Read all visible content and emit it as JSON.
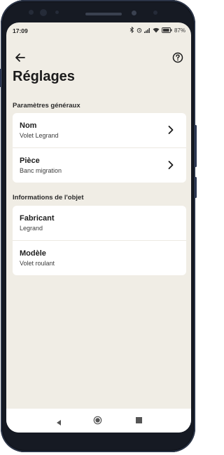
{
  "status_bar": {
    "time": "17:09",
    "battery": "87",
    "icons": [
      "bluetooth-icon",
      "alarm-icon",
      "signal-icon",
      "wifi-icon",
      "battery-icon"
    ]
  },
  "header": {
    "back_icon": "arrow-left-icon",
    "help_icon": "question-circle-icon",
    "title": "Réglages"
  },
  "sections": [
    {
      "label": "Paramètres généraux",
      "rows": [
        {
          "label": "Nom",
          "value": "Volet Legrand",
          "chevron": true
        },
        {
          "label": "Pièce",
          "value": "Banc migration",
          "chevron": true
        }
      ]
    },
    {
      "label": "Informations de l'objet",
      "rows": [
        {
          "label": "Fabricant",
          "value": "Legrand",
          "chevron": false
        },
        {
          "label": "Modèle",
          "value": "Volet roulant",
          "chevron": false
        }
      ]
    }
  ],
  "nav_bar": {
    "icons": [
      "nav-back-icon",
      "nav-home-icon",
      "nav-recents-icon"
    ]
  },
  "colors": {
    "screen_background": "#f0ede5",
    "card_background": "#ffffff",
    "text": "#1b1b1b",
    "phone_frame": "#161a23"
  }
}
